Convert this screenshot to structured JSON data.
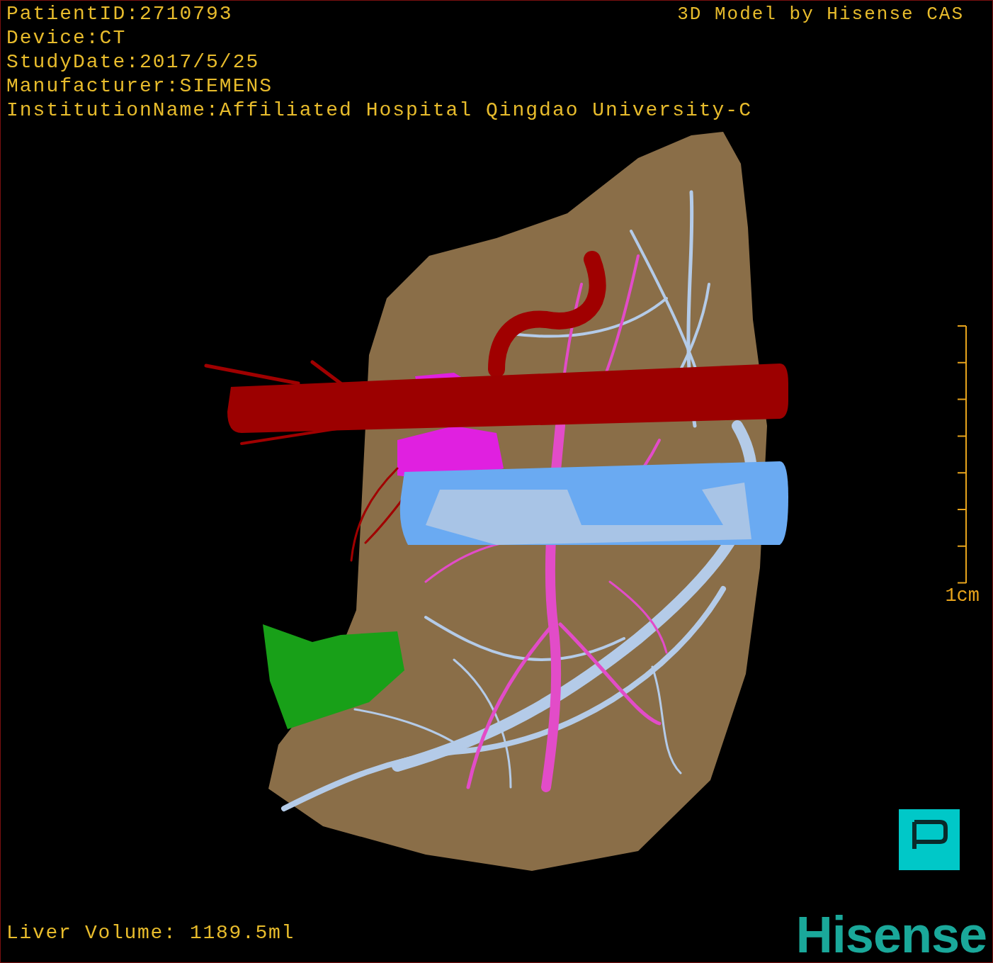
{
  "info_lines": [
    "PatientID:2710793",
    "Device:CT",
    "StudyDate:2017/5/25",
    "Manufacturer:SIEMENS",
    "InstitutionName:Affiliated Hospital Qingdao University-C"
  ],
  "model_credit": "3D Model by Hisense CAS",
  "scale_bar": {
    "label": "1cm"
  },
  "volume": "Liver Volume: 1189.5ml",
  "logo": {
    "text": "Hisense"
  }
}
